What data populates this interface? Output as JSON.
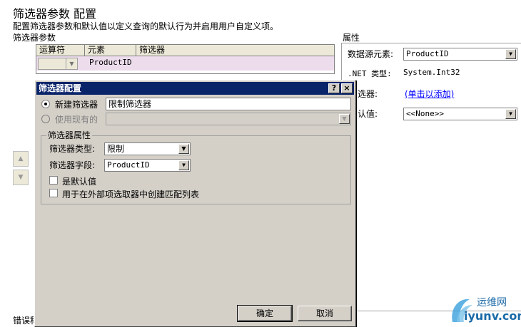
{
  "page": {
    "title": "筛选器参数 配置",
    "description": "配置筛选器参数和默认值以定义查询的默认行为并启用用户自定义项。",
    "params_label": "筛选器参数",
    "error_label": "错误科"
  },
  "grid": {
    "columns": [
      "运算符",
      "元素",
      "筛选器"
    ],
    "row": {
      "operator": "",
      "element": "ProductID",
      "filter": ""
    }
  },
  "properties": {
    "label": "属性",
    "datasource_label": "数据源元素:",
    "datasource_value": "ProductID",
    "net_type_label": ".NET 类型:",
    "net_type_value": "System.Int32",
    "filter_label": "选器:",
    "filter_link": "(单击以添加)",
    "default_label": "认值:",
    "default_value": "<<None>>"
  },
  "dialog": {
    "title": "筛选器配置",
    "help_glyph": "?",
    "close_glyph": "×",
    "new_filter_label": "新建筛选器",
    "new_filter_value": "限制筛选器",
    "use_existing_label": "使用现有的",
    "use_existing_value": "",
    "group_label": "筛选器属性",
    "filter_type_label": "筛选器类型:",
    "filter_type_value": "限制",
    "filter_field_label": "筛选器字段:",
    "filter_field_value": "ProductID",
    "is_default_label": "是默认值",
    "external_picker_label": "用于在外部项选取器中创建匹配列表",
    "ok_label": "确定",
    "cancel_label": "取消"
  },
  "watermark": {
    "cn": "运维网",
    "en": "iyunv.com"
  },
  "icons": {
    "scroll_up": "triangle-up-icon",
    "scroll_down": "triangle-down-icon",
    "dropdown": "chevron-down-icon"
  }
}
